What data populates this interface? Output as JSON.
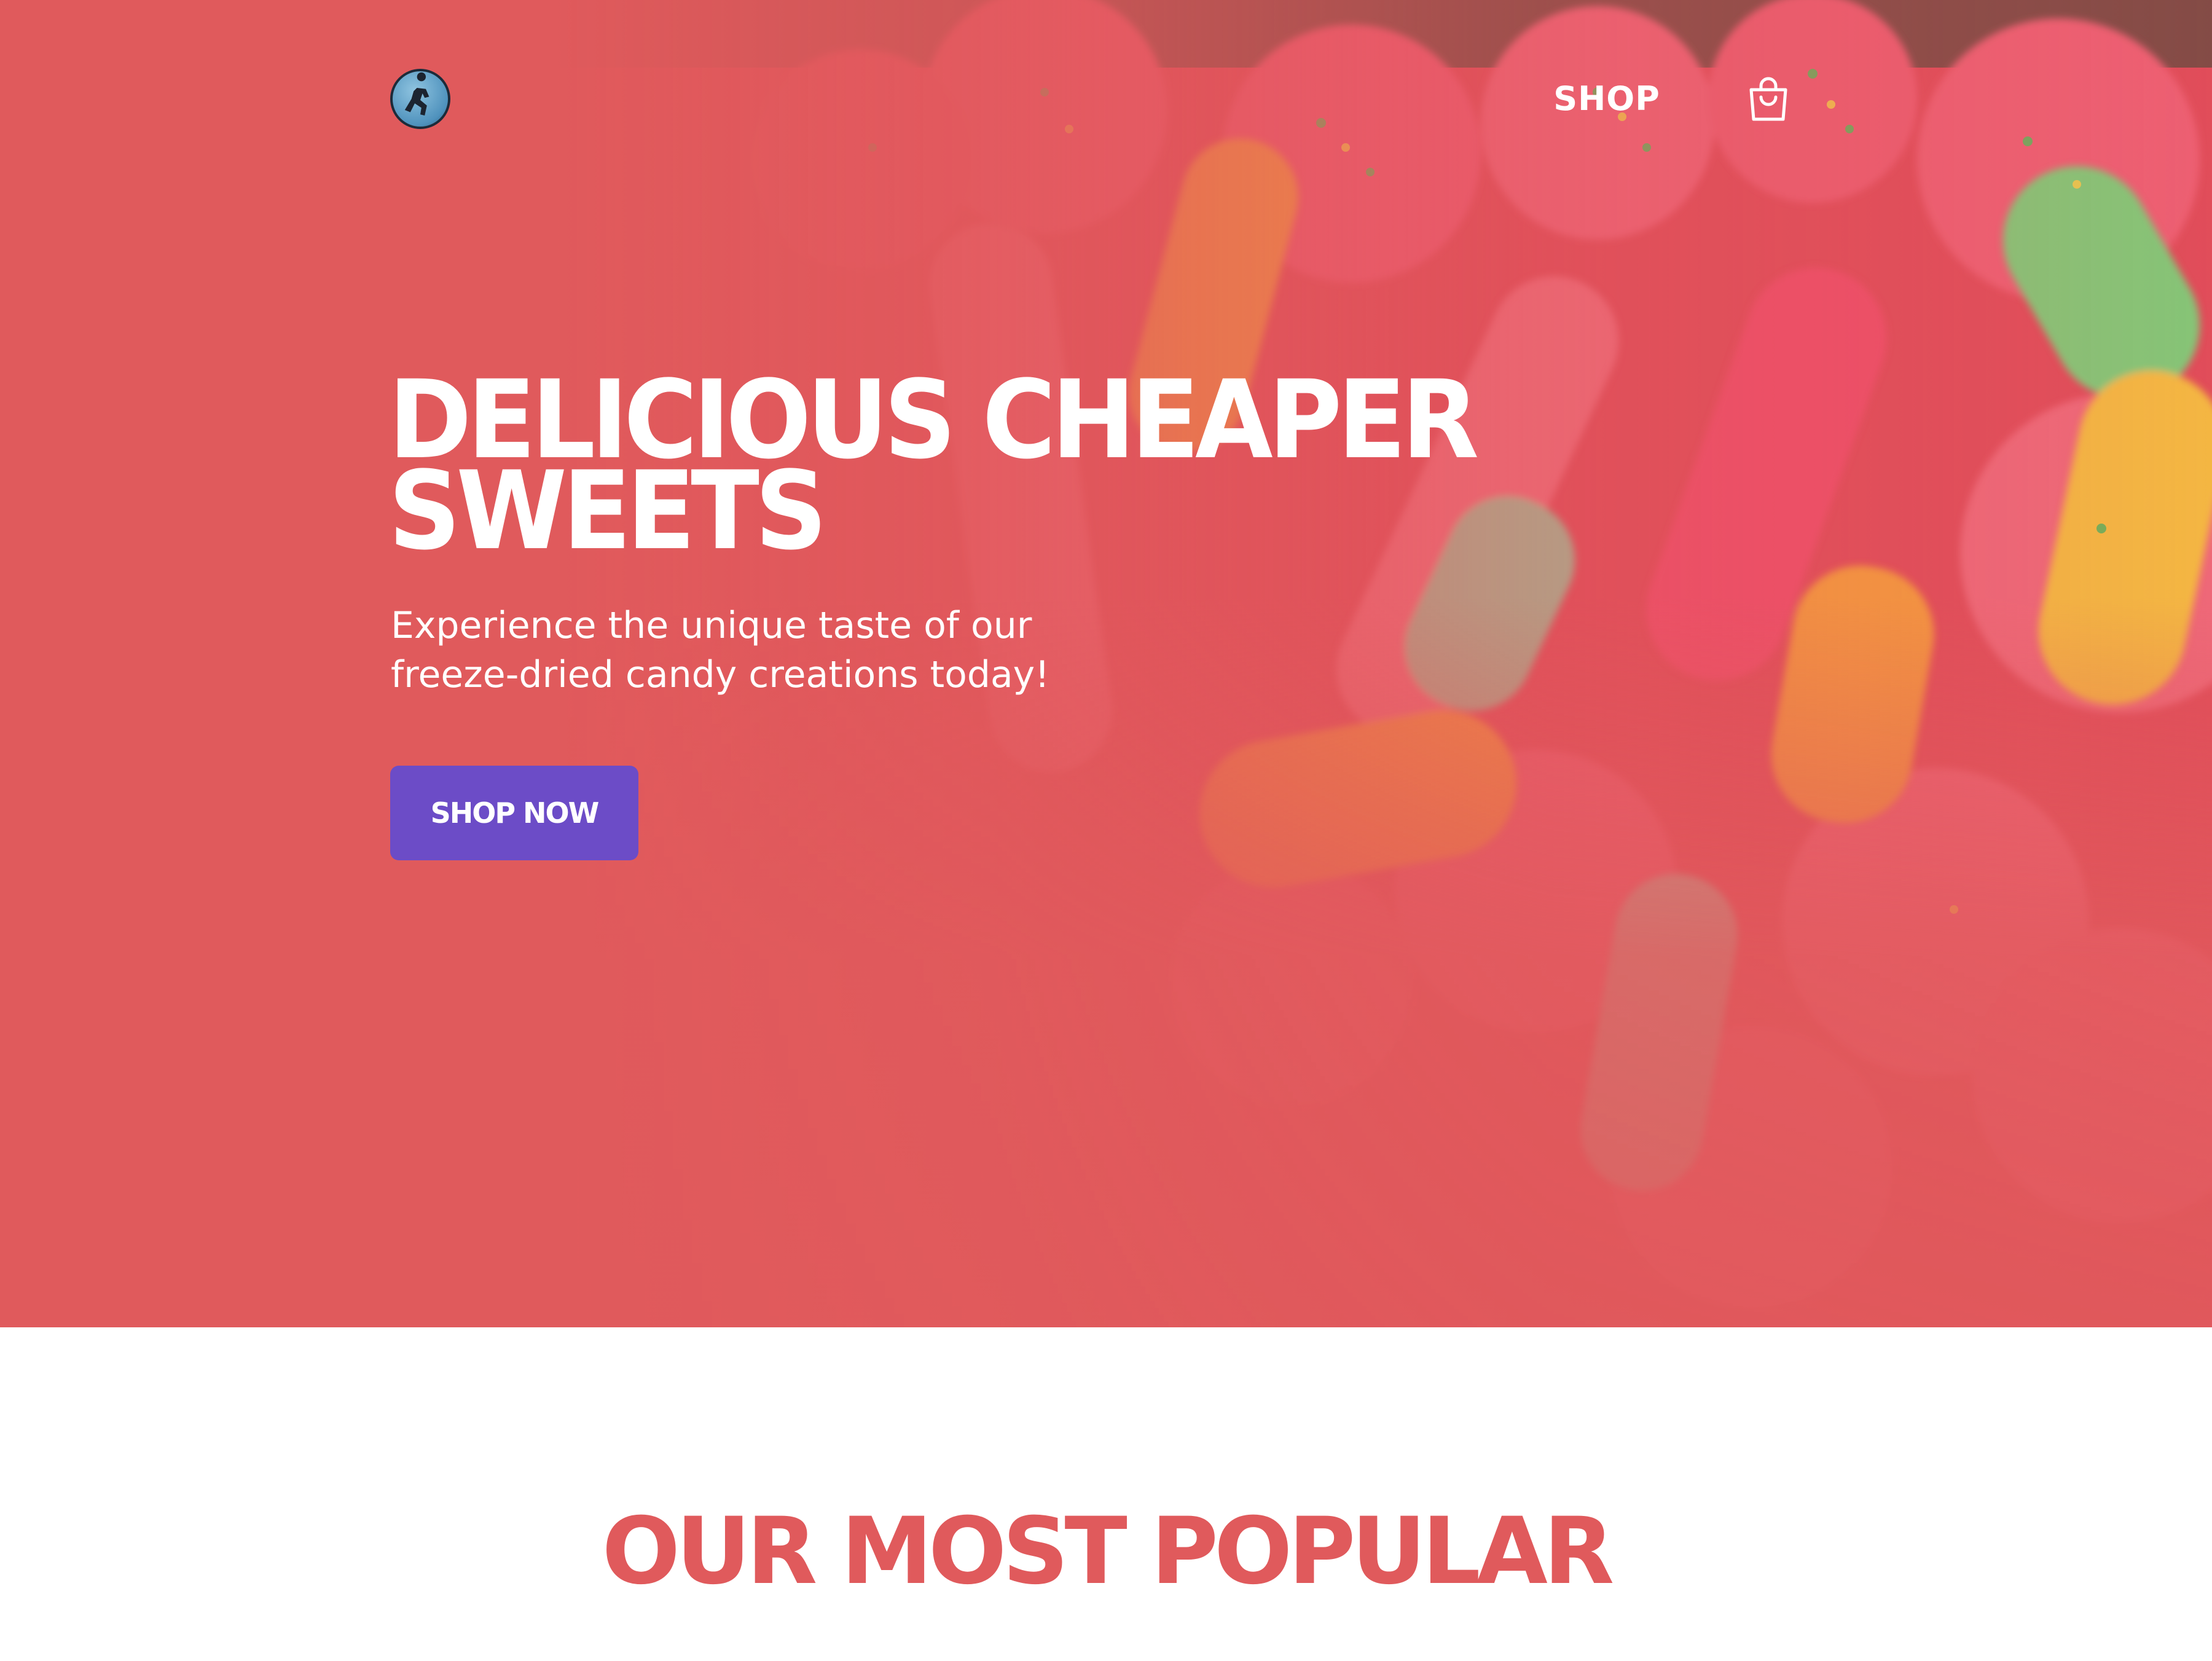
{
  "colors": {
    "hero_background": "#e05a5c",
    "button_background": "#6c4cc7",
    "section_title": "#e05a5c",
    "text_on_hero": "#ffffff"
  },
  "nav": {
    "logo_icon": "runner-logo-icon",
    "shop_label": "SHOP",
    "cart_icon": "shopping-bag-icon"
  },
  "hero": {
    "title_line1": "DELICIOUS CHEAPER",
    "title_line2": "SWEETS",
    "subtitle_line1": "Experience the unique taste of our",
    "subtitle_line2": "freeze-dried candy creations today!",
    "cta_label": "SHOP NOW"
  },
  "popular": {
    "title": "OUR MOST POPULAR"
  }
}
